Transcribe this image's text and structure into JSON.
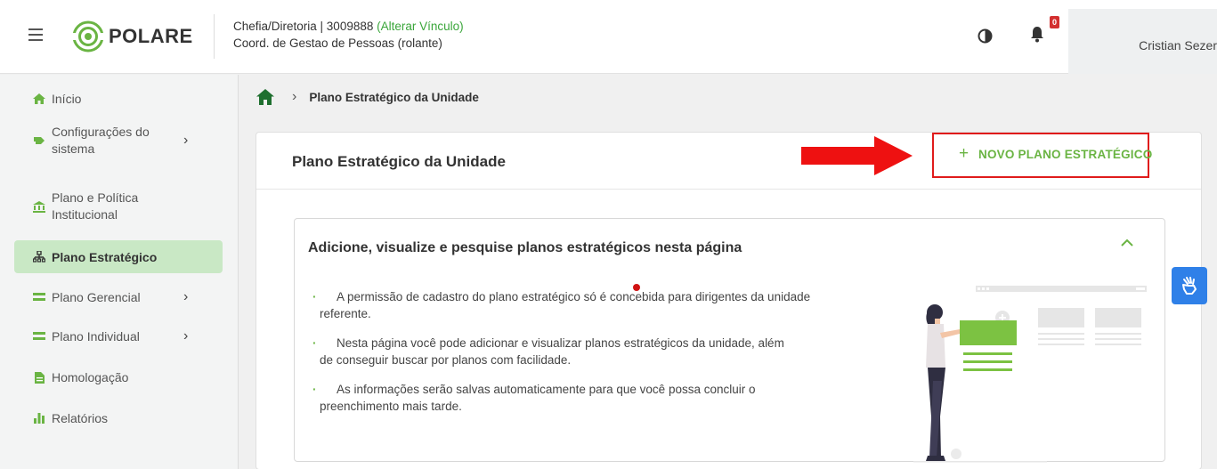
{
  "header": {
    "logo_text": "POLARE",
    "vinculo_role": "Chefia/Diretoria |  3009888",
    "vinculo_link": "(Alterar Vínculo)",
    "vinculo_unit": "Coord. de Gestao de Pessoas (rolante)",
    "notification_count": "0",
    "user_name": "Cristian Sezer"
  },
  "sidebar": {
    "items": [
      {
        "label": "Início",
        "icon": "home-icon"
      },
      {
        "label": "Configurações do sistema",
        "line1": "Configurações do",
        "line2": "sistema",
        "icon": "tools-icon",
        "expandable": true
      },
      {
        "label": "Plano e Política Institucional",
        "line1": "Plano e Política",
        "line2": "Institucional",
        "icon": "bank-icon"
      },
      {
        "label": "Plano Estratégico",
        "icon": "sitemap-icon",
        "active": true
      },
      {
        "label": "Plano Gerencial",
        "icon": "list-icon",
        "expandable": true
      },
      {
        "label": "Plano Individual",
        "icon": "list-icon",
        "expandable": true
      },
      {
        "label": "Homologação",
        "icon": "file-icon"
      },
      {
        "label": "Relatórios",
        "icon": "bar-chart-icon"
      }
    ]
  },
  "breadcrumb": {
    "current": "Plano Estratégico da Unidade"
  },
  "main": {
    "title": "Plano Estratégico da Unidade",
    "new_button_label": "NOVO PLANO ESTRATÉGICO",
    "info": {
      "title": "Adicione, visualize e pesquise planos estratégicos nesta página",
      "bullets": [
        {
          "line1": "A permissão de cadastro do plano estratégico só é concebida para dirigentes da unidade",
          "line2": "referente."
        },
        {
          "line1": "Nesta página você pode adicionar e visualizar planos estratégicos da unidade, além",
          "line2": "de conseguir buscar por planos com facilidade."
        },
        {
          "line1": "As informações serão salvas automaticamente para que você possa concluir o",
          "line2": "preenchimento mais tarde."
        }
      ]
    }
  },
  "colors": {
    "brand_green": "#6ab443",
    "active_bg": "#c9e8c5",
    "annotation_red": "#e01b1b",
    "accessibility_blue": "#2f80e8"
  }
}
